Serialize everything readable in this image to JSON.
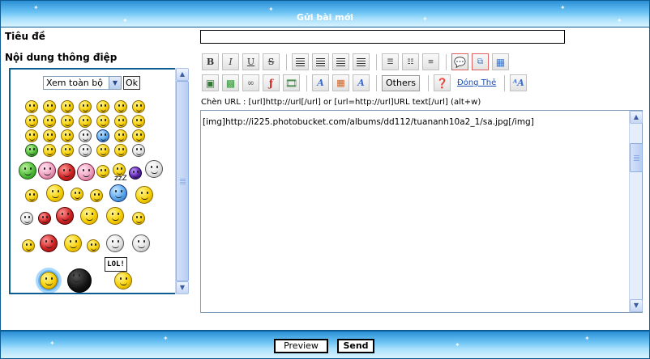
{
  "header": {
    "title": "Gửi bài mới"
  },
  "form": {
    "subject_label": "Tiêu đề",
    "content_label": "Nội dung thông điệp",
    "subject_value": ""
  },
  "smilies": {
    "select_value": "Xem toàn bộ",
    "ok_label": "Ok",
    "sign_text": "LOL!",
    "zzz_text": "zzZ"
  },
  "toolbar": {
    "row1": [
      "B",
      "I",
      "U",
      "S"
    ],
    "others_label": "Others",
    "close_tags_label": "Đóng Thẻ"
  },
  "editor": {
    "url_hint": "Chèn URL : [url]http://url[/url] or [url=http://url]URL text[/url] (alt+w)",
    "content": "[img]http://i225.photobucket.com/albums/dd112/tuananh10a2_1/sa.jpg[/img]"
  },
  "actions": {
    "preview_label": "Preview",
    "send_label": "Send"
  },
  "colors": {
    "header_blue": "#2a8fd6",
    "border_blue": "#0e5c94",
    "link_blue": "#1a4fb0"
  }
}
